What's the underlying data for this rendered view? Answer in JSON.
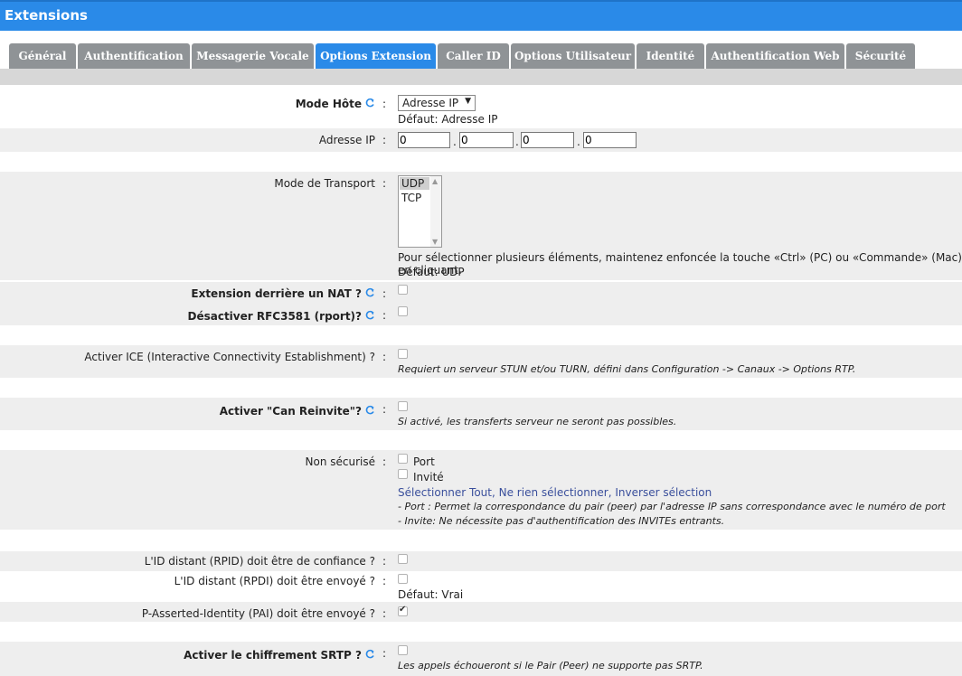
{
  "window": {
    "title": "Extensions"
  },
  "tabs": [
    {
      "label": "Général"
    },
    {
      "label": "Authentification"
    },
    {
      "label": "Messagerie Vocale"
    },
    {
      "label": "Options Extension"
    },
    {
      "label": "Caller ID"
    },
    {
      "label": "Options Utilisateur"
    },
    {
      "label": "Identité"
    },
    {
      "label": "Authentification Web"
    },
    {
      "label": "Sécurité"
    }
  ],
  "active_tab": "Options Extension",
  "colon": ":",
  "mode_hote": {
    "label": "Mode Hôte",
    "select_value": "Adresse IP",
    "default": "Défaut: Adresse IP"
  },
  "adresse_ip": {
    "label": "Adresse IP",
    "octets": [
      "0",
      "0",
      "0",
      "0"
    ],
    "separator": "."
  },
  "transport": {
    "label": "Mode de Transport",
    "options": [
      "UDP",
      "TCP"
    ],
    "selected": "UDP",
    "help": "Pour sélectionner plusieurs éléments, maintenez enfoncée la touche «Ctrl» (PC) ou «Commande» (Mac) en cliquant.",
    "default": "Défaut: UDP"
  },
  "nat": {
    "label": "Extension derrière un NAT ?",
    "checked": false
  },
  "rfc3581": {
    "label": "Désactiver RFC3581 (rport)?",
    "checked": false
  },
  "ice": {
    "label": "Activer ICE (Interactive Connectivity Establishment) ?",
    "checked": false,
    "hint": "Requiert un serveur STUN et/ou TURN, défini dans Configuration -> Canaux -> Options RTP."
  },
  "reinvite": {
    "label": "Activer \"Can Reinvite\"?",
    "checked": false,
    "hint": "Si activé, les transferts serveur ne seront pas possibles."
  },
  "insecure": {
    "label": "Non sécurisé",
    "options": [
      {
        "label": "Port",
        "checked": false
      },
      {
        "label": "Invité",
        "checked": false
      }
    ],
    "links": {
      "all": "Sélectionner Tout",
      "none": "Ne rien sélectionner",
      "invert": "Inverser sélection",
      "sep": ", "
    },
    "hint1": "- Port : Permet la correspondance du pair (peer) par l'adresse IP sans correspondance avec le numéro de port",
    "hint2": "- Invite: Ne nécessite pas d'authentification des INVITEs entrants."
  },
  "rpid_trust": {
    "label": "L'ID distant (RPID) doit être de confiance ?",
    "checked": false
  },
  "rpid_send": {
    "label": "L'ID distant (RPDI) doit être envoyé ?",
    "checked": false,
    "default": "Défaut: Vrai"
  },
  "pai": {
    "label": "P-Asserted-Identity (PAI) doit être envoyé ?",
    "checked": true
  },
  "srtp": {
    "label": "Activer le chiffrement SRTP ?",
    "checked": false,
    "hint": "Les appels échoueront si le Pair (Peer) ne supporte pas SRTP."
  },
  "colors": {
    "accent": "#2a8ae8",
    "tab_inactive": "#8f9396",
    "row_shade": "#eeeeee",
    "link": "#3a4f9c"
  }
}
